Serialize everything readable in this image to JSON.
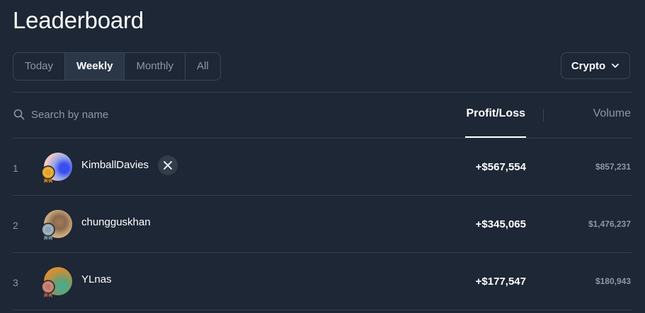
{
  "page": {
    "title": "Leaderboard"
  },
  "tabs": [
    {
      "label": "Today",
      "active": false
    },
    {
      "label": "Weekly",
      "active": true
    },
    {
      "label": "Monthly",
      "active": false
    },
    {
      "label": "All",
      "active": false
    }
  ],
  "category_dropdown": {
    "label": "Crypto",
    "icon": "chevron-down-icon"
  },
  "search": {
    "placeholder": "Search by name",
    "value": "",
    "icon": "search-icon"
  },
  "columns": {
    "profit_loss": "Profit/Loss",
    "volume": "Volume",
    "sorted_by": "Profit/Loss"
  },
  "rows": [
    {
      "rank": "1",
      "name": "KimballDavies",
      "profit_loss": "+$567,554",
      "volume": "$857,231",
      "medal": "gold",
      "has_x_link": true
    },
    {
      "rank": "2",
      "name": "chungguskhan",
      "profit_loss": "+$345,065",
      "volume": "$1,476,237",
      "medal": "silver",
      "has_x_link": false
    },
    {
      "rank": "3",
      "name": "YLnas",
      "profit_loss": "+$177,547",
      "volume": "$180,943",
      "medal": "bronze",
      "has_x_link": false
    }
  ],
  "colors": {
    "background": "#1d2735",
    "border": "#3a4656",
    "muted_text": "#8b98a8",
    "gold": "#e0a12a",
    "silver": "#8fa3b0",
    "bronze": "#c1786a"
  }
}
